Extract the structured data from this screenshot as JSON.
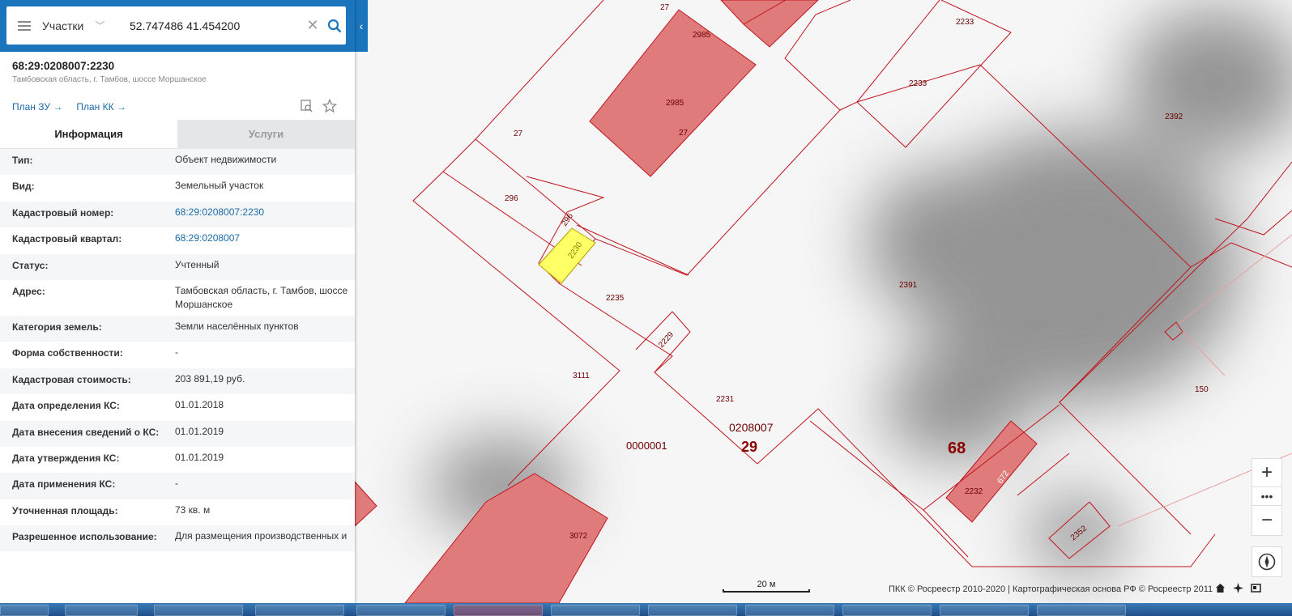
{
  "search": {
    "layer": "Участки",
    "query": "52.747486 41.454200"
  },
  "object": {
    "number": "68:29:0208007:2230",
    "address": "Тамбовская область, г. Тамбов, шоссе Моршанское",
    "plan_zu": "План ЗУ →",
    "plan_kk": "План КК →"
  },
  "tabs": [
    {
      "label": "Информация",
      "active": true
    },
    {
      "label": "Услуги",
      "active": false
    }
  ],
  "info": [
    {
      "key": "Тип:",
      "value": "Объект недвижимости"
    },
    {
      "key": "Вид:",
      "value": "Земельный участок"
    },
    {
      "key": "Кадастровый номер:",
      "value": "68:29:0208007:2230",
      "link": true
    },
    {
      "key": "Кадастровый квартал:",
      "value": "68:29:0208007",
      "link": true
    },
    {
      "key": "Статус:",
      "value": "Учтенный"
    },
    {
      "key": "Адрес:",
      "value": "Тамбовская область, г. Тамбов, шоссе Моршанское"
    },
    {
      "key": "Категория земель:",
      "value": "Земли населённых пунктов"
    },
    {
      "key": "Форма собственности:",
      "value": "-"
    },
    {
      "key": "Кадастровая стоимость:",
      "value": "203 891,19 руб."
    },
    {
      "key": "Дата определения КС:",
      "value": "01.01.2018"
    },
    {
      "key": "Дата внесения сведений о КС:",
      "value": "01.01.2019"
    },
    {
      "key": "Дата утверждения КС:",
      "value": "01.01.2019"
    },
    {
      "key": "Дата применения КС:",
      "value": "-"
    },
    {
      "key": "Уточненная площадь:",
      "value": "73 кв. м"
    },
    {
      "key": "Разрешенное использование:",
      "value": "Для размещения производственных и"
    }
  ],
  "map": {
    "labels": {
      "p27a": "27",
      "p2985a": "2985",
      "p2985b": "2985",
      "p27b": "27",
      "p27c": "27",
      "p2233a": "2233",
      "p2233b": "2233",
      "p2392": "2392",
      "p296a": "296",
      "p296b": "296",
      "p2230": "2230",
      "p2235": "2235",
      "p2391": "2391",
      "p2229": "2229",
      "p3111": "3111",
      "p2231": "2231",
      "p150": "150",
      "q0208007": "0208007",
      "q29": "29",
      "q0000001": "0000001",
      "q68": "68",
      "p2232": "2232",
      "p672": "672",
      "p3072": "3072",
      "p2352": "2352"
    },
    "highlight_color": "#ffff66",
    "building_color": "#e07b7b",
    "border_color": "#c0141e"
  },
  "controls": {
    "zoom_in": "+",
    "zoom_more": "•••",
    "zoom_out": "−",
    "scale_label": "20 м",
    "copyright": "ПКК © Росреестр 2010-2020 | Картографическая основа РФ © Росреестр 2011"
  }
}
